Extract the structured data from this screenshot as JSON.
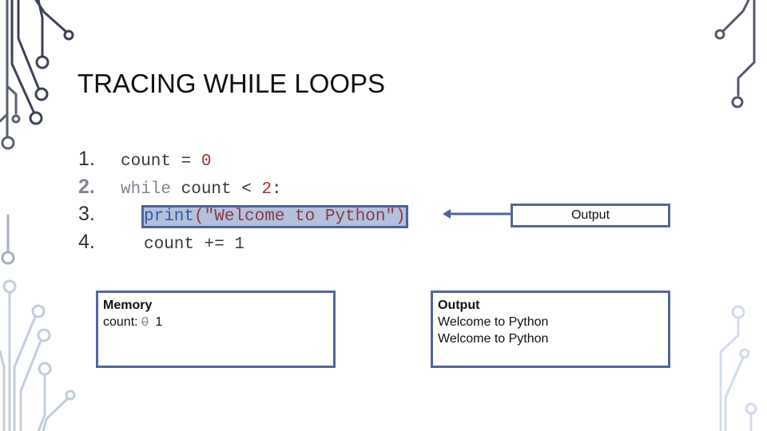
{
  "slide": {
    "title": "TRACING WHILE LOOPS"
  },
  "code": {
    "lines": [
      {
        "number": "1.",
        "parts": [
          "count = ",
          "0"
        ]
      },
      {
        "number": "2.",
        "parts": [
          "while",
          " count < ",
          "2",
          ":"
        ]
      },
      {
        "number": "3.",
        "parts": [
          "print",
          "(\"Welcome to Python\")"
        ]
      },
      {
        "number": "4.",
        "parts": [
          "count += 1"
        ]
      }
    ],
    "active_line": "2",
    "highlighted_line": "3"
  },
  "arrow_label": {
    "text": "Output"
  },
  "memory": {
    "heading": "Memory",
    "variable": "count:",
    "old_value": "0",
    "current_value": "1"
  },
  "output": {
    "heading": "Output",
    "lines": [
      "Welcome to Python",
      "Welcome to Python"
    ]
  },
  "colors": {
    "accent_border": "#53679a",
    "highlight_fill": "#b4c0dc",
    "number_literal": "#a03030",
    "keyword_blue": "#2e5aa8"
  },
  "icons": {
    "decoration": "circuit-trace-icon",
    "arrow": "arrow-left-icon"
  }
}
